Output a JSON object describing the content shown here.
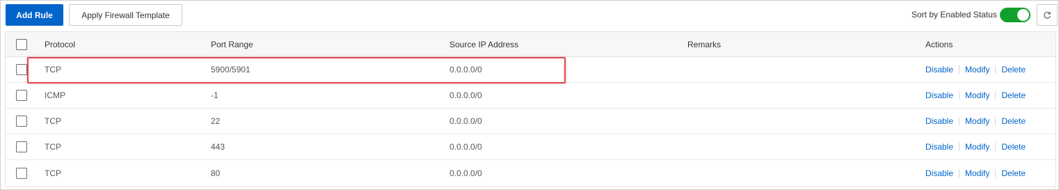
{
  "toolbar": {
    "add_rule_label": "Add Rule",
    "apply_template_label": "Apply Firewall Template",
    "sort_label": "Sort by Enabled Status",
    "sort_enabled": true,
    "toggle_color": "#12a02c",
    "primary_color": "#0064c8",
    "refresh_icon": "refresh-icon"
  },
  "table": {
    "headers": {
      "protocol": "Protocol",
      "port_range": "Port Range",
      "source_ip": "Source IP Address",
      "remarks": "Remarks",
      "actions": "Actions"
    },
    "rows": [
      {
        "protocol": "TCP",
        "port_range": "5900/5901",
        "source_ip": "0.0.0.0/0",
        "remarks": "",
        "highlighted": true
      },
      {
        "protocol": "ICMP",
        "port_range": "-1",
        "source_ip": "0.0.0.0/0",
        "remarks": ""
      },
      {
        "protocol": "TCP",
        "port_range": "22",
        "source_ip": "0.0.0.0/0",
        "remarks": ""
      },
      {
        "protocol": "TCP",
        "port_range": "443",
        "source_ip": "0.0.0.0/0",
        "remarks": ""
      },
      {
        "protocol": "TCP",
        "port_range": "80",
        "source_ip": "0.0.0.0/0",
        "remarks": ""
      }
    ],
    "actions": {
      "disable": "Disable",
      "modify": "Modify",
      "delete": "Delete"
    }
  },
  "highlight_color": "#e0464a"
}
